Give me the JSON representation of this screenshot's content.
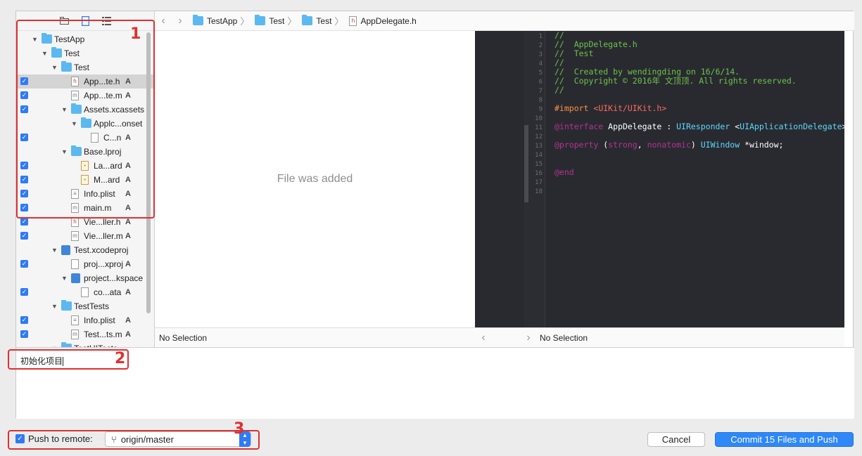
{
  "navigator": {
    "tools": [
      "folder-icon",
      "file-icon",
      "list-icon"
    ],
    "items": [
      {
        "name": "TestApp",
        "indent": 0,
        "type": "folder",
        "expanded": true,
        "checked": false,
        "status": ""
      },
      {
        "name": "Test",
        "indent": 1,
        "type": "folder",
        "expanded": true,
        "checked": false,
        "status": ""
      },
      {
        "name": "Test",
        "indent": 2,
        "type": "folder",
        "expanded": true,
        "checked": false,
        "status": ""
      },
      {
        "name": "App...te.h",
        "indent": 3,
        "type": "h",
        "checked": true,
        "status": "A",
        "selected": true
      },
      {
        "name": "App...te.m",
        "indent": 3,
        "type": "m",
        "checked": true,
        "status": "A"
      },
      {
        "name": "Assets.xcassets",
        "indent": 3,
        "type": "folder",
        "expanded": true,
        "checked": true,
        "status": ""
      },
      {
        "name": "Applc...onset",
        "indent": 4,
        "type": "folder",
        "expanded": true,
        "checked": false,
        "status": ""
      },
      {
        "name": "C...n",
        "indent": 5,
        "type": "doc",
        "checked": true,
        "status": "A"
      },
      {
        "name": "Base.lproj",
        "indent": 3,
        "type": "folder",
        "expanded": true,
        "checked": false,
        "status": ""
      },
      {
        "name": "La...ard",
        "indent": 4,
        "type": "sb",
        "checked": true,
        "status": "A"
      },
      {
        "name": "M...ard",
        "indent": 4,
        "type": "sb",
        "checked": true,
        "status": "A"
      },
      {
        "name": "Info.plist",
        "indent": 3,
        "type": "plist",
        "checked": true,
        "status": "A"
      },
      {
        "name": "main.m",
        "indent": 3,
        "type": "m",
        "checked": true,
        "status": "A"
      },
      {
        "name": "Vie...ller.h",
        "indent": 3,
        "type": "h",
        "checked": true,
        "status": "A"
      },
      {
        "name": "Vie...ller.m",
        "indent": 3,
        "type": "m",
        "checked": true,
        "status": "A"
      },
      {
        "name": "Test.xcodeproj",
        "indent": 2,
        "type": "proj",
        "expanded": true,
        "checked": false,
        "status": ""
      },
      {
        "name": "proj...xproj",
        "indent": 3,
        "type": "doc",
        "checked": true,
        "status": "A"
      },
      {
        "name": "project...kspace",
        "indent": 3,
        "type": "proj",
        "expanded": true,
        "checked": false,
        "status": ""
      },
      {
        "name": "co...ata",
        "indent": 4,
        "type": "doc",
        "checked": true,
        "status": "A"
      },
      {
        "name": "TestTests",
        "indent": 2,
        "type": "folder",
        "expanded": true,
        "checked": false,
        "status": ""
      },
      {
        "name": "Info.plist",
        "indent": 3,
        "type": "plist",
        "checked": true,
        "status": "A"
      },
      {
        "name": "Test...ts.m",
        "indent": 3,
        "type": "m",
        "checked": true,
        "status": "A"
      },
      {
        "name": "TestUITests",
        "indent": 2,
        "type": "folder",
        "expanded": true,
        "checked": false,
        "status": ""
      }
    ]
  },
  "jumpbar": {
    "crumbs": [
      {
        "label": "TestApp",
        "icon": "folder-icon"
      },
      {
        "label": "Test",
        "icon": "folder-icon"
      },
      {
        "label": "Test",
        "icon": "folder-icon"
      },
      {
        "label": "AppDelegate.h",
        "icon": "header-file-icon"
      }
    ]
  },
  "left_pane": {
    "message": "File was added",
    "footer": "No Selection"
  },
  "right_pane": {
    "footer": "No Selection",
    "line_numbers": [
      "1",
      "2",
      "3",
      "4",
      "5",
      "6",
      "7",
      "8",
      "9",
      "10",
      "11",
      "12",
      "13",
      "14",
      "15",
      "16",
      "17",
      "18"
    ],
    "code": [
      [
        {
          "t": "//",
          "c": "com"
        }
      ],
      [
        {
          "t": "//  AppDelegate.h",
          "c": "com"
        }
      ],
      [
        {
          "t": "//  Test",
          "c": "com"
        }
      ],
      [
        {
          "t": "//",
          "c": "com"
        }
      ],
      [
        {
          "t": "//  Created by wendingding on 16/6/14.",
          "c": "com"
        }
      ],
      [
        {
          "t": "//  Copyright © 2016年 文顶顶. All rights reserved.",
          "c": "com"
        }
      ],
      [
        {
          "t": "//",
          "c": "com"
        }
      ],
      [],
      [
        {
          "t": "#import ",
          "c": "pre"
        },
        {
          "t": "<UIKit/UIKit.h>",
          "c": "str"
        }
      ],
      [],
      [
        {
          "t": "@interface",
          "c": "kw"
        },
        {
          "t": " AppDelegate : ",
          "c": "txt"
        },
        {
          "t": "UIResponder",
          "c": "cls"
        },
        {
          "t": " <",
          "c": "txt"
        },
        {
          "t": "UIApplicationDelegate",
          "c": "cls"
        },
        {
          "t": ">",
          "c": "txt"
        }
      ],
      [],
      [
        {
          "t": "@property",
          "c": "kw"
        },
        {
          "t": " (",
          "c": "txt"
        },
        {
          "t": "strong",
          "c": "kw"
        },
        {
          "t": ", ",
          "c": "txt"
        },
        {
          "t": "nonatomic",
          "c": "kw"
        },
        {
          "t": ") ",
          "c": "txt"
        },
        {
          "t": "UIWindow",
          "c": "cls"
        },
        {
          "t": " *window;",
          "c": "txt"
        }
      ],
      [],
      [],
      [
        {
          "t": "@end",
          "c": "kw"
        }
      ],
      [],
      []
    ]
  },
  "commit_message": "初始化项目",
  "push": {
    "label": "Push to remote:",
    "checked": true,
    "branch": "origin/master"
  },
  "buttons": {
    "cancel": "Cancel",
    "commit": "Commit 15 Files and Push"
  },
  "annotations": [
    "1",
    "2",
    "3"
  ],
  "colors": {
    "accent": "#2f88f7",
    "annotation": "#e03030",
    "editor_bg": "#292a30"
  }
}
